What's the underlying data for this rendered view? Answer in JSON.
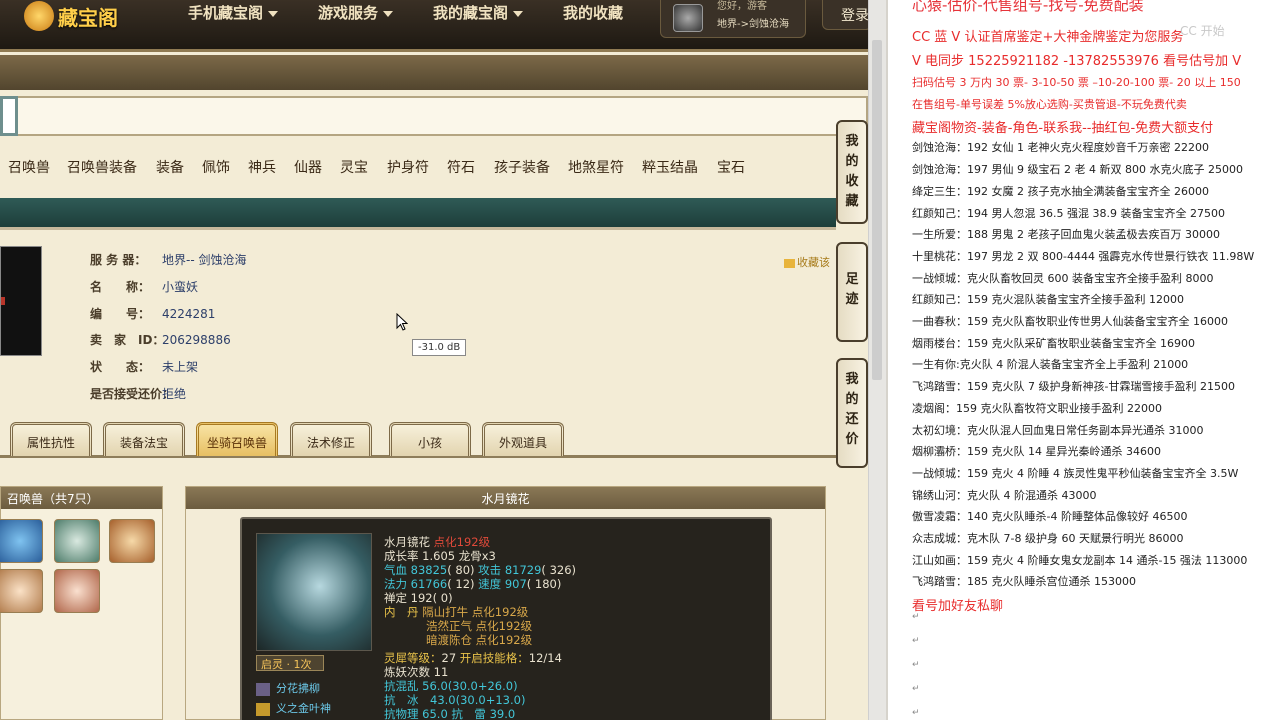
{
  "nav": {
    "logo_text": "藏宝阁",
    "items": [
      "手机藏宝阁",
      "游戏服务",
      "我的藏宝阁",
      "我的收藏"
    ],
    "user_hello": "您好，游客",
    "user_server": "地界->剑蚀沧海",
    "login": "登录"
  },
  "categories": [
    "召唤兽",
    "召唤兽装备",
    "装备",
    "佩饰",
    "神兵",
    "仙器",
    "灵宝",
    "护身符",
    "符石",
    "孩子装备",
    "地煞星符",
    "粹玉结晶",
    "宝石"
  ],
  "info": {
    "rows": [
      {
        "label": "服 务 器：",
        "value": "地界-- 剑蚀沧海"
      },
      {
        "label": "名　　称：",
        "value": "小蛮妖"
      },
      {
        "label": "编　　号：",
        "value": "4224281"
      },
      {
        "label": "卖　家　ID：",
        "value": "206298886"
      },
      {
        "label": "状　　态：",
        "value": "未上架"
      },
      {
        "label": "是否接受还价：",
        "value": "拒绝"
      }
    ],
    "favorite": "收藏该"
  },
  "tooltip": "-31.0 dB",
  "tabs": [
    "属性抗性",
    "装备法宝",
    "坐骑召唤兽",
    "法术修正",
    "小孩",
    "外观道具"
  ],
  "active_tab": "坐骑召唤兽",
  "pet_list": {
    "header": "召唤兽（共7只）"
  },
  "detail": {
    "header": "水月镜花",
    "name": "水月镜花",
    "dianhua": "点化192级",
    "growth": "成长率 1.605 龙骨x3",
    "qixue_label": "气血",
    "qixue": "83825",
    "qixue_x": "( 80)",
    "gongji_label": "攻击",
    "gongji": "81729",
    "gongji_x": "( 326)",
    "fali_label": "法力",
    "fali": "61766",
    "fali_x": "( 12)",
    "sudu_label": "速度",
    "sudu": "907",
    "sudu_x": "( 180)",
    "chanding": "禅定 192( 0)",
    "neidan_label": "内　丹",
    "neidan": [
      {
        "name": "隔山打牛",
        "level": "点化192级"
      },
      {
        "name": "浩然正气",
        "level": "点化192级"
      },
      {
        "name": "暗渡陈仓",
        "level": "点化192级"
      }
    ],
    "lingxi": "灵犀等级：",
    "lingxi_val": "27",
    "kaiqi": "开启技能格：",
    "kaiqi_val": "12/14",
    "lianyao": "炼妖次数 11",
    "kanghun": "抗混乱 56.0(30.0+26.0)",
    "kangbing": "抗　冰　43.0(30.0+13.0)",
    "kangwuli": "抗物理 65.0 抗　雷 39.0",
    "qiling": "启灵 · 1次",
    "skills": [
      "分花拂柳",
      "义之金叶神"
    ]
  },
  "side_tabs": [
    "我的收藏",
    "足迹",
    "我的还价"
  ],
  "notes": {
    "title": "心猿-估价-代售组号-找号-免费配装",
    "watermark": "CC 开始",
    "lines": [
      {
        "text": "CC 蓝 V 认证首席鉴定+大神金牌鉴定为您服务",
        "red": true,
        "big": true
      },
      {
        "text": "V 电同步 15225921182 -13782553976 看号估号加 V",
        "red": true,
        "big": true
      },
      {
        "text": "扫码估号 3 万内 30 票- 3-10-50 票 –10-20-100 票- 20 以上 150",
        "red": true
      },
      {
        "text": "在售组号-单号误差 5%放心选购-买贵管退-不玩免费代卖",
        "red": true
      },
      {
        "text": "藏宝阁物资-装备-角色-联系我--抽红包-免费大额支付",
        "red": true,
        "big": true
      },
      {
        "text": "剑蚀沧海：192 女仙 1 老神火克火程度妙音千万亲密 22200",
        "red": false
      },
      {
        "text": "剑蚀沧海：197 男仙 9 级宝石 2 老 4 新双 800 水克火底子 25000",
        "red": false
      },
      {
        "text": "绛定三生：192 女魔 2 孩子克水抽全满装备宝宝齐全 26000",
        "red": false
      },
      {
        "text": "红颜知己：194 男人忽混 36.5 强混 38.9 装备宝宝齐全 27500",
        "red": false
      },
      {
        "text": "一生所爱：188 男鬼 2 老孩子回血鬼火装孟极去疾百万 30000",
        "red": false
      },
      {
        "text": "十里桃花：197 男龙 2 双 800-4444 强霹克水传世景行铁衣 11.98W",
        "red": false
      },
      {
        "text": "一战倾城：克火队畜牧回灵 600 装备宝宝齐全接手盈利 8000",
        "red": false
      },
      {
        "text": "红颜知己：159 克火混队装备宝宝齐全接手盈利 12000",
        "red": false
      },
      {
        "text": "一曲春秋：159 克火队畜牧职业传世男人仙装备宝宝齐全 16000",
        "red": false
      },
      {
        "text": "烟雨楼台：159 克火队采矿畜牧职业装备宝宝齐全 16900",
        "red": false
      },
      {
        "text": "一生有你:克火队 4 阶混人装备宝宝齐全上手盈利 21000",
        "red": false
      },
      {
        "text": "飞鸿踏雪：159 克火队 7 级护身新神孩-甘霖瑞雪接手盈利 21500",
        "red": false
      },
      {
        "text": "凌烟阁：159 克火队畜牧符文职业接手盈利 22000",
        "red": false
      },
      {
        "text": "太初幻境：克火队混人回血鬼日常任务副本异光通杀 31000",
        "red": false
      },
      {
        "text": "烟柳灞桥：159 克火队 14 星异光秦岭通杀 34600",
        "red": false
      },
      {
        "text": "一战倾城：159 克火 4 阶睡 4 族灵性鬼平秒仙装备宝宝齐全 3.5W",
        "red": false
      },
      {
        "text": "锦绣山河：克火队 4 阶混通杀 43000",
        "red": false
      },
      {
        "text": "傲雪凌霜：140 克火队睡杀-4 阶睡整体品像较好 46500",
        "red": false
      },
      {
        "text": "众志成城：克木队 7-8 级护身 60 天赋景行明光 86000",
        "red": false
      },
      {
        "text": "江山如画：159 克火 4 阶睡女鬼女龙副本 14 通杀-15 强法 113000",
        "red": false
      },
      {
        "text": "飞鸿踏雪：185 克火队睡杀宫位通杀 153000",
        "red": false
      },
      {
        "text": "看号加好友私聊",
        "red": true,
        "big": true
      }
    ]
  },
  "colors": {
    "accent_red": "#e82c2c",
    "nav_bg": "#2a221a",
    "green_bar": "#2b5450",
    "page_bg": "#f3ecd6"
  }
}
